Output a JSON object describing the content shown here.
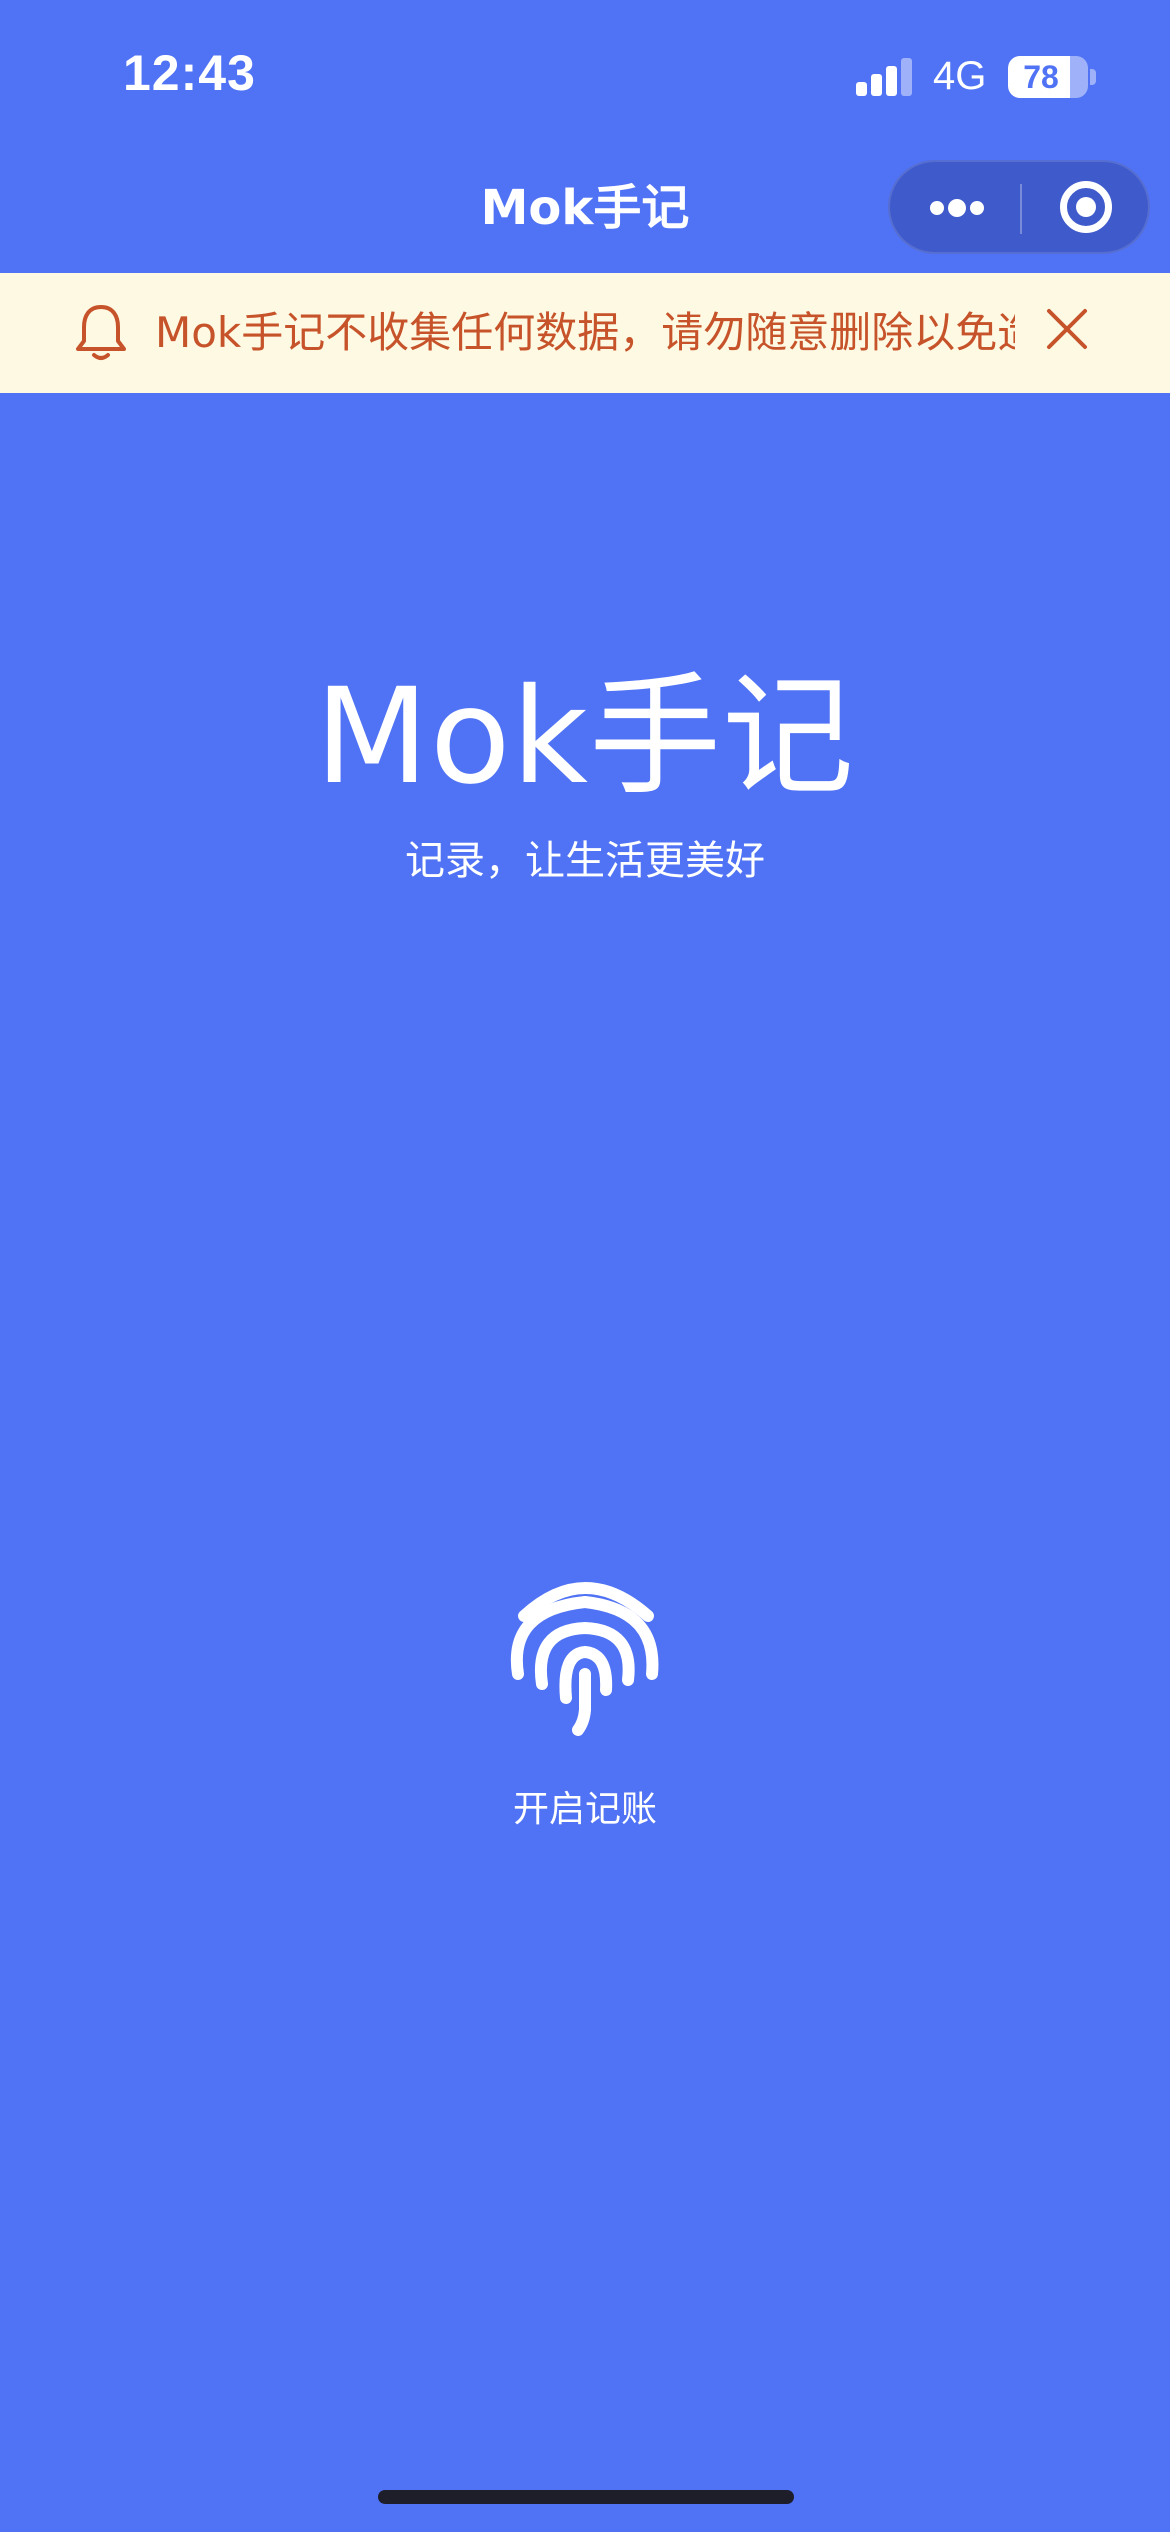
{
  "status_bar": {
    "time": "12:43",
    "network": "4G",
    "battery": "78",
    "battery_level": 0.78
  },
  "nav": {
    "title": "Mok手记",
    "more_icon": "more-dots-icon",
    "close_icon": "target-close-icon"
  },
  "notice": {
    "icon": "bell-icon",
    "text": "Mok手记不收集任何数据，请勿随意删除以免造",
    "close_icon": "close-icon",
    "text_color": "#C6532A",
    "background": "#FDF9E2"
  },
  "hero": {
    "title": "Mok手记",
    "subtitle": "记录，让生活更美好"
  },
  "start": {
    "icon": "fingerprint-icon",
    "label": "开启记账"
  },
  "colors": {
    "background": "#5073F5",
    "capsule": "#3F5BCB"
  }
}
